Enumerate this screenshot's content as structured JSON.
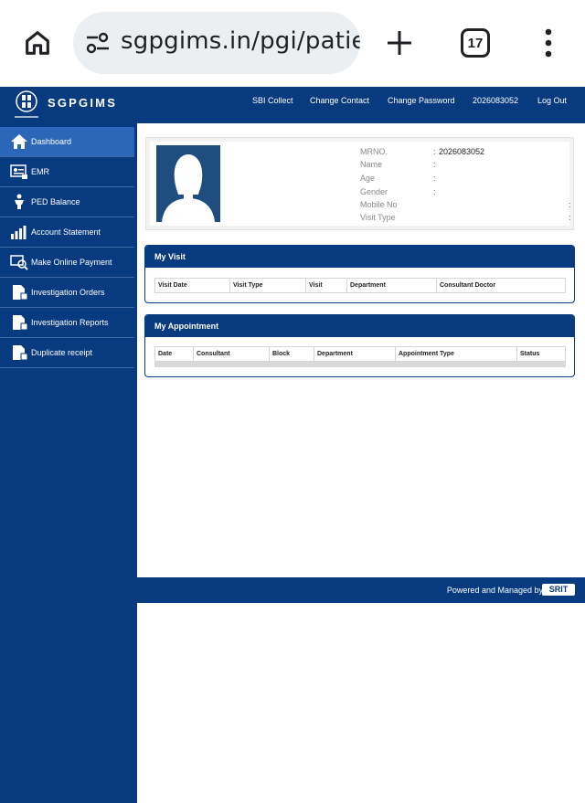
{
  "browser": {
    "url": "sgpgims.in/pgi/patient",
    "tab_count": "17",
    "icons": [
      "home-icon",
      "site-settings-icon",
      "plus-icon",
      "tab-switcher-icon",
      "more-vert-icon"
    ]
  },
  "header": {
    "logo_text": "SGPGIMS",
    "nav": [
      "SBI Collect",
      "Change Contact",
      "Change Password",
      "2026083052",
      "Log Out"
    ]
  },
  "sidebar": {
    "items": [
      {
        "label": "Dashboard",
        "icon": "home-icon",
        "active": true
      },
      {
        "label": "EMR",
        "icon": "emr-icon",
        "active": false
      },
      {
        "label": "PED Balance",
        "icon": "ped-balance-icon",
        "active": false
      },
      {
        "label": "Account Statement",
        "icon": "bar-chart-icon",
        "active": false
      },
      {
        "label": "Make Online Payment",
        "icon": "online-payment-icon",
        "active": false
      },
      {
        "label": "Investigation Orders",
        "icon": "document-icon",
        "active": false
      },
      {
        "label": "Investigation Reports",
        "icon": "document-icon",
        "active": false
      },
      {
        "label": "Duplicate receipt",
        "icon": "document-icon",
        "active": false
      }
    ]
  },
  "profile": {
    "fields": [
      {
        "label": "MRNO.",
        "value": "2026083052"
      },
      {
        "label": "Name",
        "value": ""
      },
      {
        "label": "Age",
        "value": ""
      },
      {
        "label": "Gender",
        "value": ""
      },
      {
        "label": "Mobile No",
        "value": ""
      },
      {
        "label": "Visit Type",
        "value": ""
      }
    ]
  },
  "my_visit": {
    "title": "My Visit",
    "columns": [
      "Visit Date",
      "Visit Type",
      "Visit",
      "Department",
      "Consultant Doctor"
    ]
  },
  "my_appointment": {
    "title": "My Appointment",
    "columns": [
      "Date",
      "Consultant",
      "Block",
      "Department",
      "Appointment Type",
      "Status"
    ]
  },
  "footer": {
    "text": "Powered and Managed by",
    "brand": "SRIT"
  },
  "colors": {
    "primary": "#073a7e",
    "active": "#2c66b8"
  }
}
